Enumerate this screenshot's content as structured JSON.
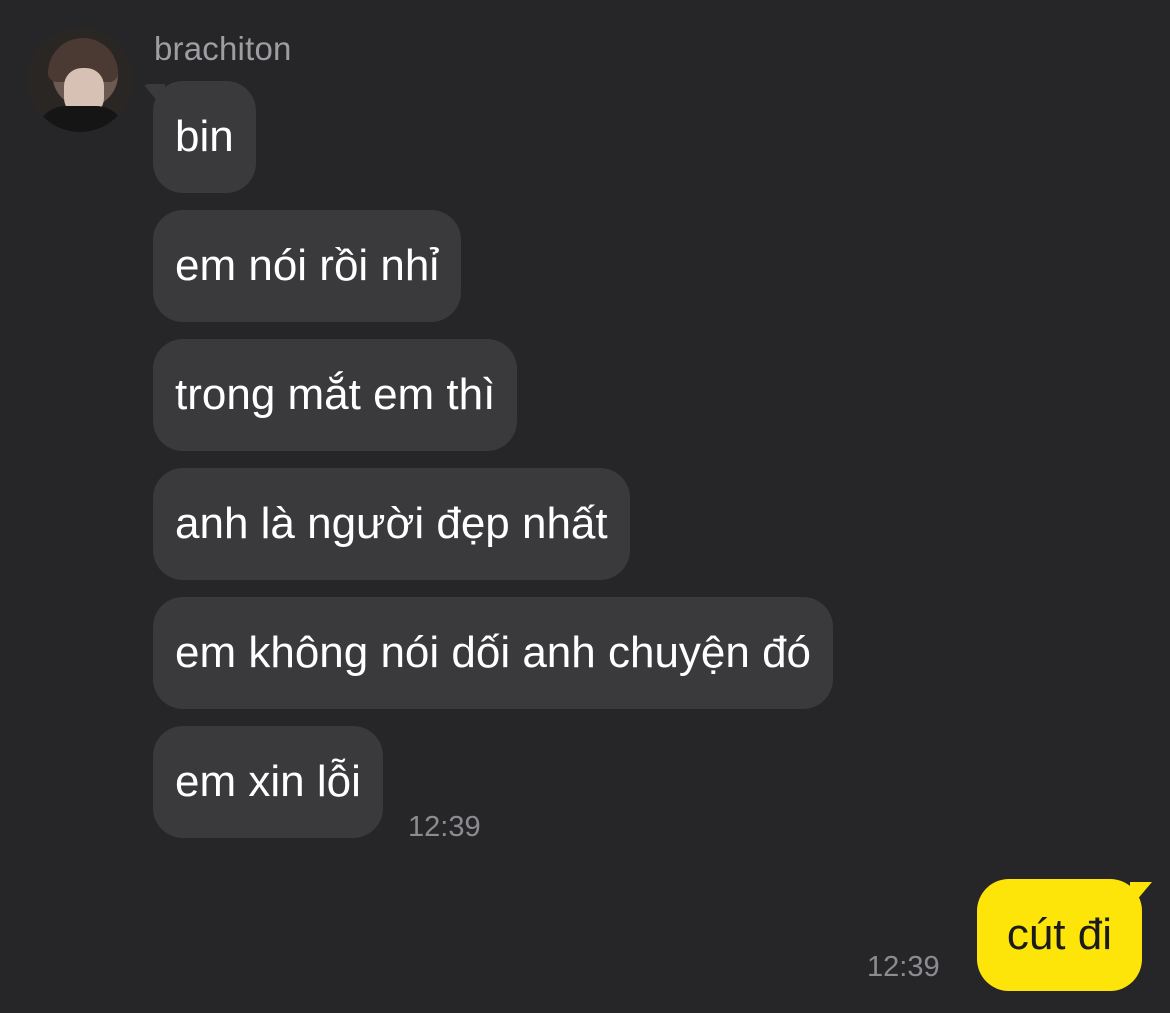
{
  "conversation": {
    "sender": "brachiton",
    "incoming": [
      "bin",
      "em nói rồi nhỉ",
      "trong mắt em thì",
      "anh là người đẹp nhất",
      "em không nói dối anh chuyện đó",
      "em xin lỗi"
    ],
    "incoming_time": "12:39",
    "outgoing": "cút đi",
    "outgoing_time": "12:39"
  },
  "colors": {
    "background": "#262628",
    "incoming_bubble": "#3a3a3c",
    "outgoing_bubble": "#fde50a"
  }
}
